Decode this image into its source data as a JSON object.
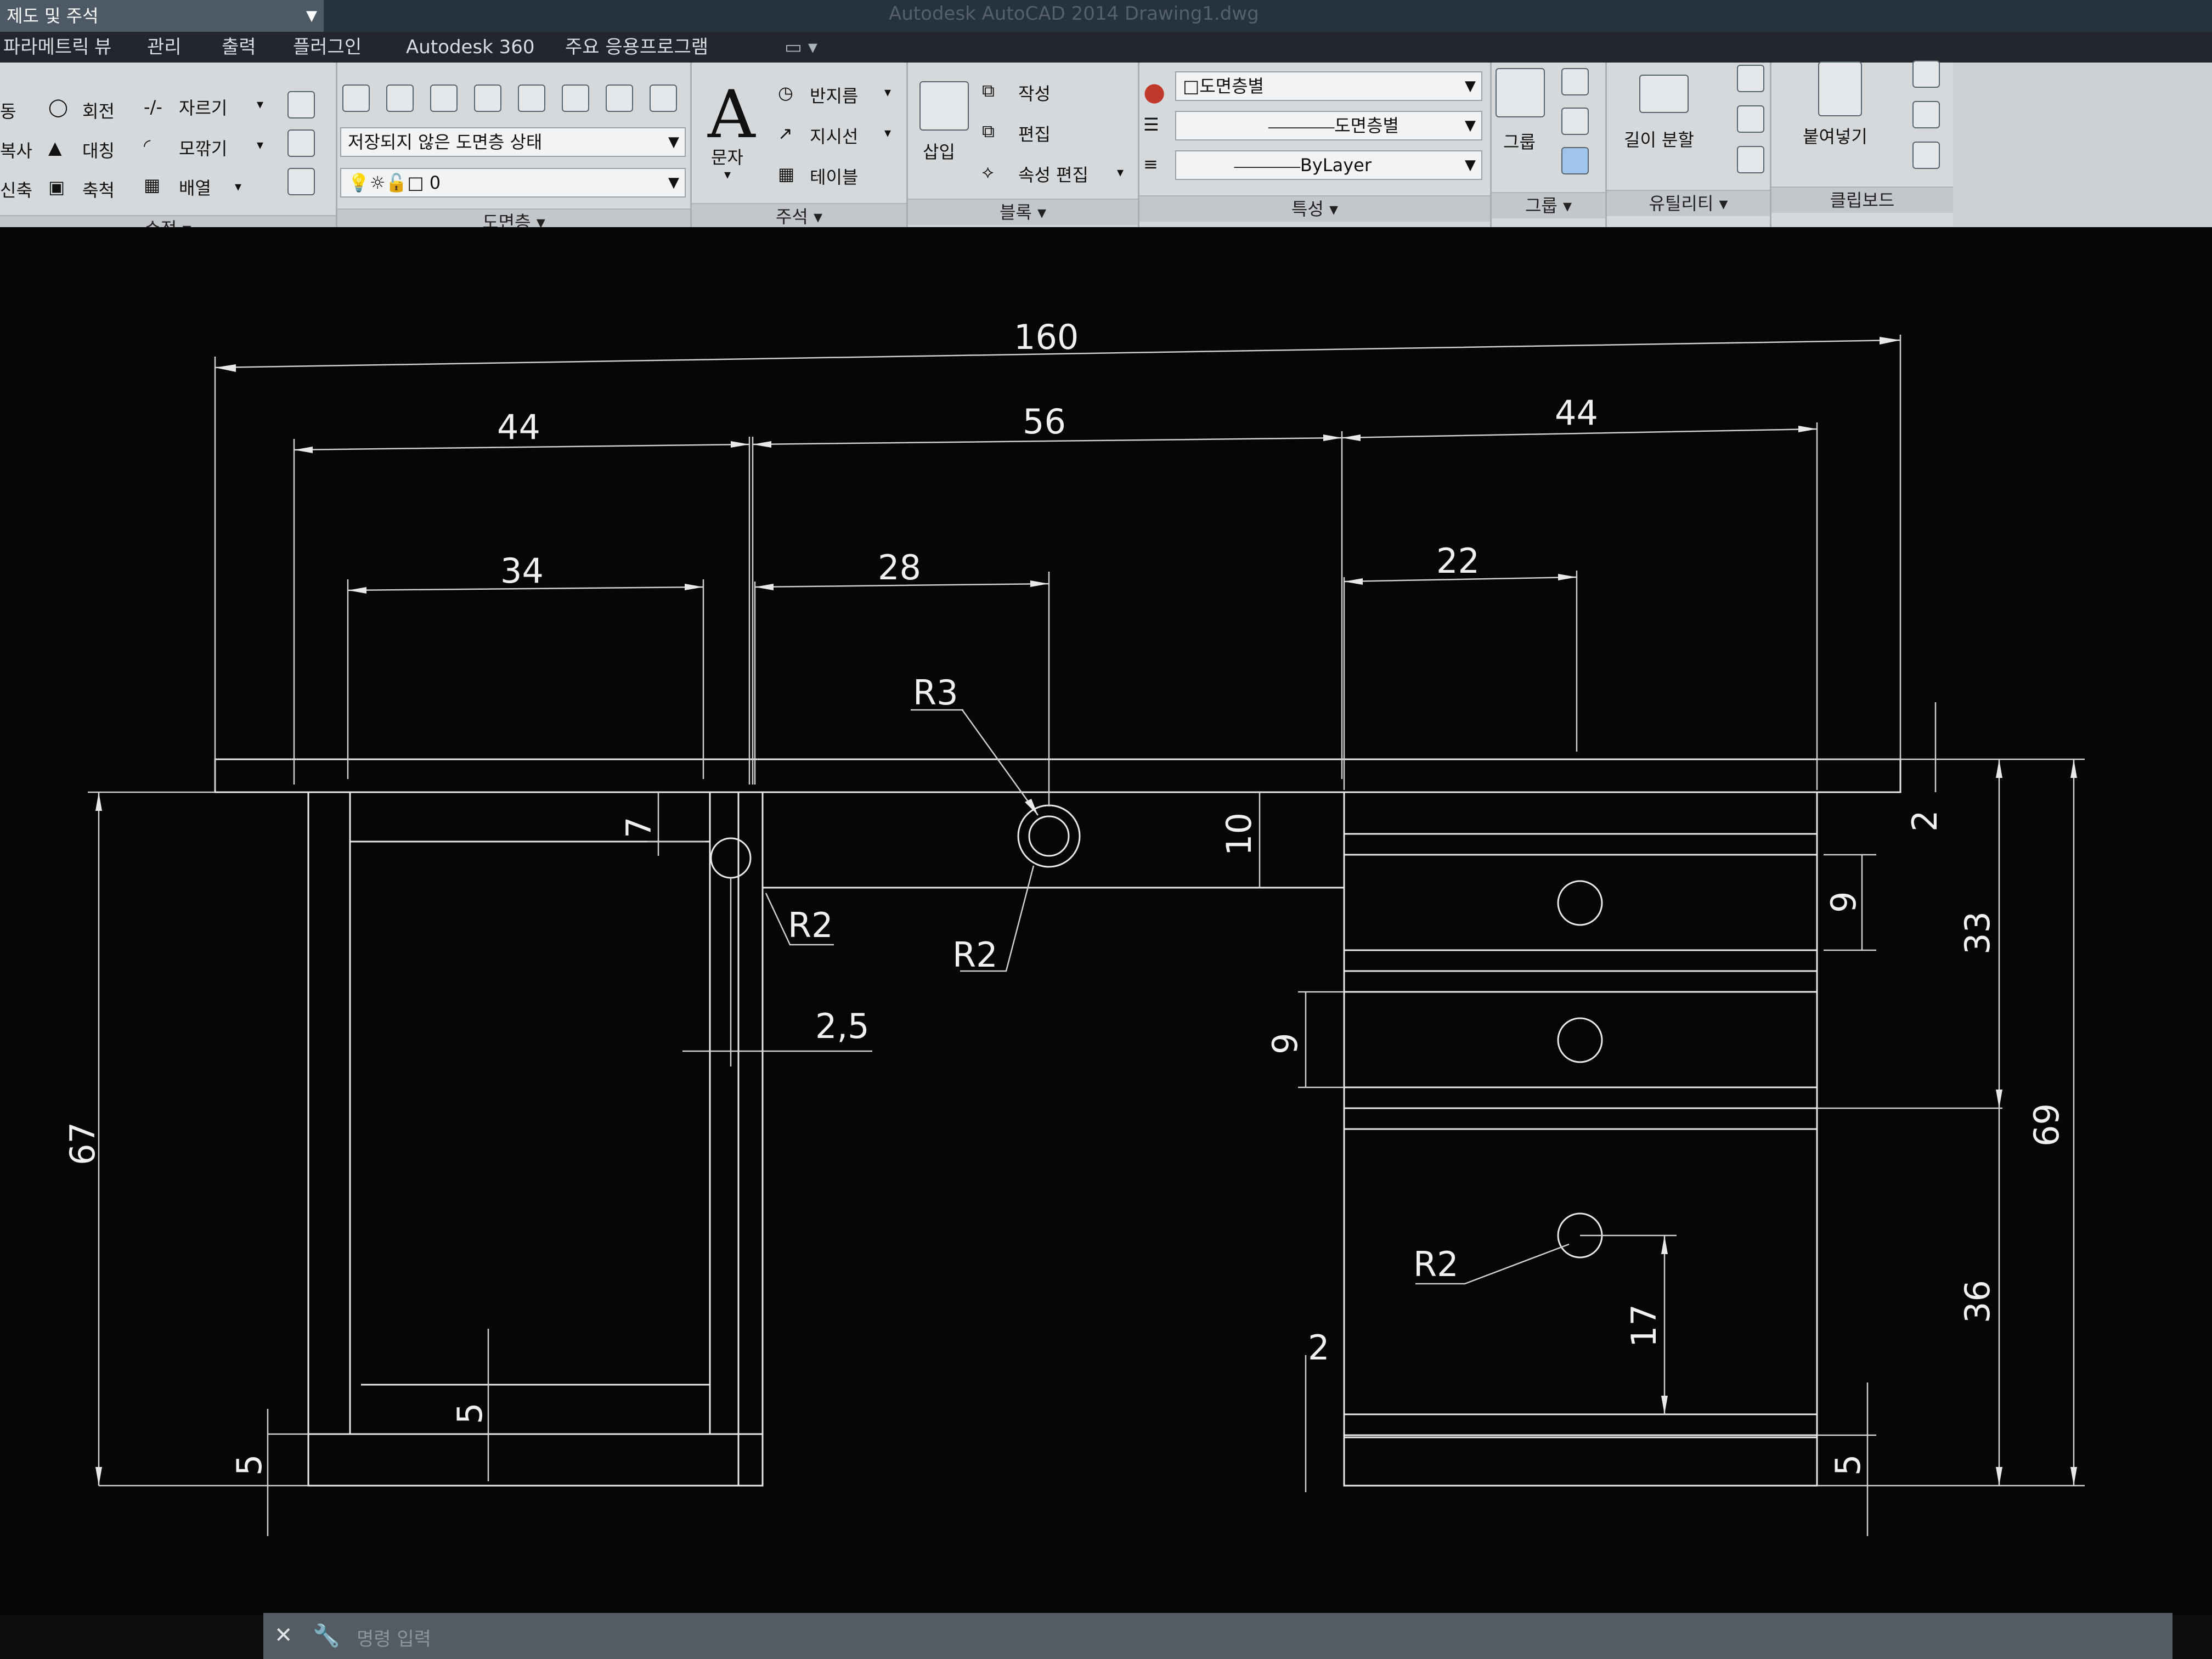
{
  "window": {
    "workspace_label": "제도 및 주석",
    "app_title": "Autodesk AutoCAD 2014   Drawing1.dwg"
  },
  "ribbon_tabs": [
    "파라메트릭",
    "뷰",
    "관리",
    "출력",
    "플러그인",
    "Autodesk 360",
    "주요 응용프로그램"
  ],
  "modify_panel": {
    "items": [
      "회전",
      "자르기",
      "대칭",
      "모깎기",
      "축척",
      "배열"
    ],
    "left_cut": [
      "동",
      "복사",
      "신축"
    ],
    "title": "수정"
  },
  "layers_panel": {
    "state_combo": "저장되지 않은 도면층 상태",
    "layer_combo": "0",
    "title": "도면층"
  },
  "annotation_panel": {
    "text_label": "문자",
    "dimension": "반지름",
    "leader": "지시선",
    "table": "테이블",
    "title": "주석"
  },
  "block_panel": {
    "insert": "삽입",
    "create": "작성",
    "edit": "편집",
    "edit_attributes": "속성 편집",
    "title": "블록"
  },
  "properties_panel": {
    "color": "도면층별",
    "lineweight": "도면층별",
    "linetype": "ByLayer",
    "title": "특성"
  },
  "groups_panel": {
    "group_label": "그룹",
    "title": "그룹"
  },
  "utilities_panel": {
    "measure_label": "길이 분할",
    "title": "유틸리티"
  },
  "clipboard_panel": {
    "paste_label": "붙여넣기",
    "title": "클립보드"
  },
  "command_line": {
    "placeholder": "명령 입력"
  },
  "drawing": {
    "dim_overall": "160",
    "dim_left_44": "44",
    "dim_mid_56": "56",
    "dim_right_44": "44",
    "dim_34": "34",
    "dim_28": "28",
    "dim_22": "22",
    "dim_7": "7",
    "dim_10": "10",
    "dim_2_5": "2,5",
    "dim_67": "67",
    "dim_5_left_outer": "5",
    "dim_5_left_inner": "5",
    "dim_9_upper": "9",
    "dim_9_lower": "9",
    "dim_2_right": "2",
    "dim_2_bottom": "2",
    "dim_17": "17",
    "dim_33": "33",
    "dim_36": "36",
    "dim_69": "69",
    "dim_5_right": "5",
    "label_r3": "R3",
    "label_r2_a": "R2",
    "label_r2_b": "R2",
    "label_r2_c": "R2"
  }
}
